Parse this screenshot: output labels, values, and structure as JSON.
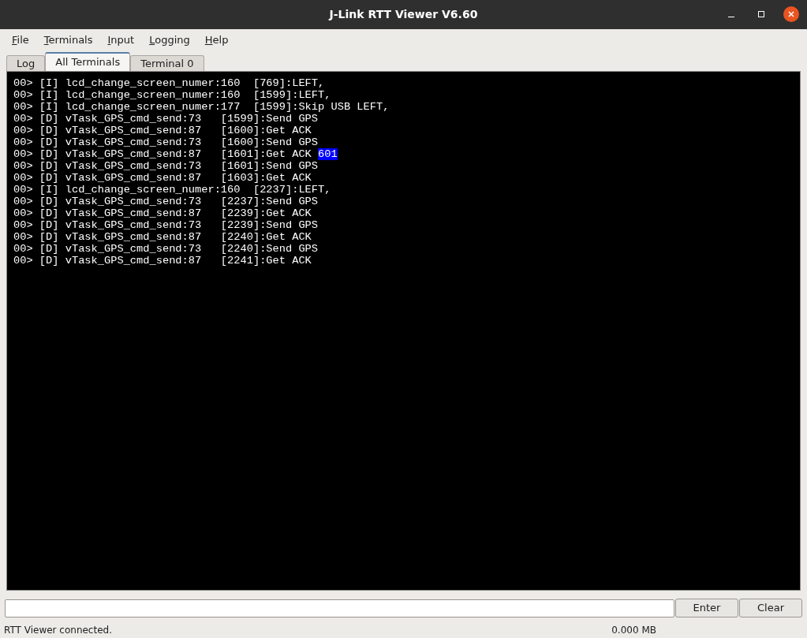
{
  "window": {
    "title": "J-Link RTT Viewer V6.60"
  },
  "menu": [
    "File",
    "Terminals",
    "Input",
    "Logging",
    "Help"
  ],
  "tabs": [
    {
      "label": "Log",
      "selected": false
    },
    {
      "label": "All Terminals",
      "selected": true
    },
    {
      "label": "Terminal 0",
      "selected": false
    }
  ],
  "terminal": {
    "lines": [
      {
        "text": "00> [I] lcd_change_screen_numer:160  [769]:LEFT,"
      },
      {
        "text": "00> [I] lcd_change_screen_numer:160  [1599]:LEFT,"
      },
      {
        "text": "00> [I] lcd_change_screen_numer:177  [1599]:Skip USB LEFT,"
      },
      {
        "text": "00> [D] vTask_GPS_cmd_send:73   [1599]:Send GPS"
      },
      {
        "text": "00> [D] vTask_GPS_cmd_send:87   [1600]:Get ACK"
      },
      {
        "text": "00> [D] vTask_GPS_cmd_send:73   [1600]:Send GPS"
      },
      {
        "text": "00> [D] vTask_GPS_cmd_send:87   [1601]:Get ACK ",
        "selection": "601"
      },
      {
        "text": "00> [D] vTask_GPS_cmd_send:73   [1601]:Send GPS"
      },
      {
        "text": "00> [D] vTask_GPS_cmd_send:87   [1603]:Get ACK"
      },
      {
        "text": "00> [I] lcd_change_screen_numer:160  [2237]:LEFT,"
      },
      {
        "text": "00> [D] vTask_GPS_cmd_send:73   [2237]:Send GPS"
      },
      {
        "text": "00> [D] vTask_GPS_cmd_send:87   [2239]:Get ACK"
      },
      {
        "text": "00> [D] vTask_GPS_cmd_send:73   [2239]:Send GPS"
      },
      {
        "text": "00> [D] vTask_GPS_cmd_send:87   [2240]:Get ACK"
      },
      {
        "text": "00> [D] vTask_GPS_cmd_send:73   [2240]:Send GPS"
      },
      {
        "text": "00> [D] vTask_GPS_cmd_send:87   [2241]:Get ACK"
      }
    ]
  },
  "input": {
    "buttons": [
      "Enter",
      "Clear"
    ]
  },
  "status_bar": {
    "message": "RTT Viewer connected.",
    "size": "0.000 MB"
  }
}
